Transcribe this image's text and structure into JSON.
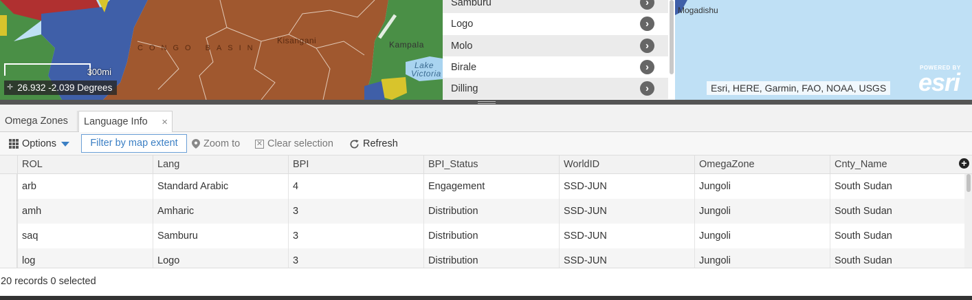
{
  "map": {
    "labels": {
      "kisangani": "Kisangani",
      "congo_basin": "CONGO BASIN",
      "kampala": "Kampala",
      "lake_victoria_1": "Lake",
      "lake_victoria_2": "Victoria",
      "mogadishu": "Mogadishu"
    },
    "scale_label": "300mi",
    "coordinates": "26.932 -2.039 Degrees",
    "attribution": "Esri, HERE, Garmin, FAO, NOAA, USGS",
    "esri_powered": "POWERED BY",
    "esri_brand": "esri",
    "colors": {
      "brown": "#a0582f",
      "blue": "#3f5fa8",
      "green": "#4a8f46",
      "lake": "#a9d4f0",
      "ocean": "#bfe0f5",
      "yellow": "#d8c42c",
      "red": "#b03030"
    }
  },
  "popup_list": {
    "items": [
      {
        "label": "Samburu"
      },
      {
        "label": "Logo"
      },
      {
        "label": "Molo"
      },
      {
        "label": "Birale"
      },
      {
        "label": "Dilling"
      }
    ],
    "go_icon": "chevron-right-circle-icon"
  },
  "tabs": [
    {
      "label": "Omega Zones",
      "active": false
    },
    {
      "label": "Language Info",
      "active": true,
      "close": "×"
    }
  ],
  "toolbar": {
    "options_label": "Options",
    "filter_label": "Filter by map extent",
    "zoom_label": "Zoom to",
    "clear_label": "Clear selection",
    "refresh_label": "Refresh"
  },
  "table": {
    "columns": [
      "ROL",
      "Lang",
      "BPI",
      "BPI_Status",
      "WorldID",
      "OmegaZone",
      "Cnty_Name"
    ],
    "rows": [
      [
        "arb",
        "Standard Arabic",
        "4",
        "Engagement",
        "SSD-JUN",
        "Jungoli",
        "South Sudan"
      ],
      [
        "amh",
        "Amharic",
        "3",
        "Distribution",
        "SSD-JUN",
        "Jungoli",
        "South Sudan"
      ],
      [
        "saq",
        "Samburu",
        "3",
        "Distribution",
        "SSD-JUN",
        "Jungoli",
        "South Sudan"
      ],
      [
        "log",
        "Logo",
        "3",
        "Distribution",
        "SSD-JUN",
        "Jungoli",
        "South Sudan"
      ]
    ]
  },
  "footer": {
    "status": "20 records 0 selected"
  }
}
